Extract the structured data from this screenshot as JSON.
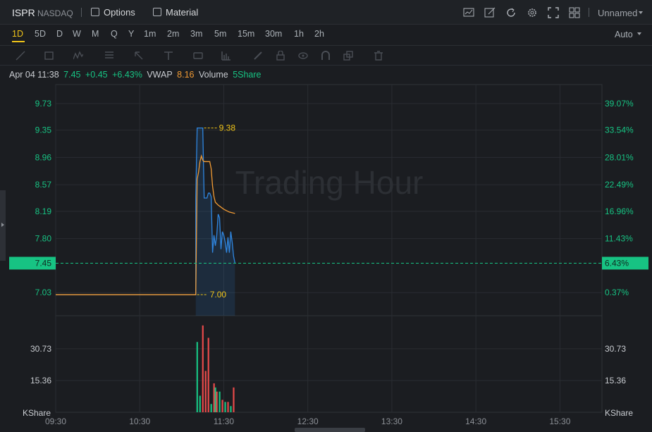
{
  "header": {
    "symbol": "ISPR",
    "exchange": "NASDAQ",
    "options_label": "Options",
    "material_label": "Material",
    "layout_name": "Unnamed"
  },
  "timeframes": {
    "items": [
      "1D",
      "5D",
      "D",
      "W",
      "M",
      "Q",
      "Y",
      "1m",
      "2m",
      "3m",
      "5m",
      "15m",
      "30m",
      "1h",
      "2h"
    ],
    "active": "1D",
    "scale_mode": "Auto"
  },
  "info_bar": {
    "datetime": "Apr 04 11:38",
    "price": "7.45",
    "change": "+0.45",
    "change_pct": "+6.43%",
    "vwap_label": "VWAP",
    "vwap_value": "8.16",
    "volume_label": "Volume",
    "volume_value": "5Share"
  },
  "watermark": "Trading Hour",
  "colors": {
    "up": "#17c383",
    "down": "#e84a4a",
    "price_line": "#2f86e0",
    "vwap_line": "#f09a34",
    "label_yellow": "#f0c419",
    "accent": "#f0c419"
  },
  "chart_data": {
    "type": "line",
    "x_ticks": [
      "09:30",
      "10:30",
      "11:30",
      "12:30",
      "13:30",
      "14:30",
      "15:30"
    ],
    "price_ticks": [
      "9.73",
      "9.35",
      "8.96",
      "8.57",
      "8.19",
      "7.80",
      "7.03"
    ],
    "pct_ticks": [
      "39.07%",
      "33.54%",
      "28.01%",
      "22.49%",
      "16.96%",
      "11.43%",
      "0.37%"
    ],
    "last_price_label": "7.45",
    "last_pct_label": "6.43%",
    "high_label": "9.38",
    "low_label": "7.00",
    "ylim": [
      6.7,
      10.0
    ],
    "series": [
      {
        "name": "Price",
        "x": [
          "09:30",
          "11:10",
          "11:10",
          "11:11",
          "11:12",
          "11:13",
          "11:14",
          "11:15",
          "11:16",
          "11:17",
          "11:18",
          "11:19",
          "11:20",
          "11:21",
          "11:22",
          "11:23",
          "11:24",
          "11:25",
          "11:26",
          "11:27",
          "11:28",
          "11:29",
          "11:30",
          "11:31",
          "11:32",
          "11:33",
          "11:34",
          "11:35",
          "11:36",
          "11:37",
          "11:38"
        ],
        "values": [
          7.0,
          7.0,
          8.4,
          9.38,
          9.38,
          9.38,
          9.38,
          9.38,
          8.38,
          8.38,
          8.38,
          8.45,
          8.45,
          8.4,
          7.6,
          7.85,
          7.7,
          7.85,
          8.15,
          8.1,
          7.65,
          7.9,
          7.85,
          7.75,
          7.6,
          7.82,
          7.6,
          7.9,
          7.75,
          7.55,
          7.45
        ]
      },
      {
        "name": "VWAP",
        "x": [
          "09:30",
          "11:10",
          "11:11",
          "11:12",
          "11:13",
          "11:14",
          "11:15",
          "11:16",
          "11:17",
          "11:18",
          "11:19",
          "11:20",
          "11:21",
          "11:22",
          "11:23",
          "11:24",
          "11:26",
          "11:28",
          "11:30",
          "11:32",
          "11:34",
          "11:36",
          "11:38"
        ],
        "values": [
          7.0,
          7.0,
          8.65,
          8.75,
          8.9,
          8.98,
          8.92,
          8.9,
          8.9,
          8.9,
          8.9,
          8.9,
          8.8,
          8.55,
          8.4,
          8.32,
          8.28,
          8.25,
          8.22,
          8.2,
          8.18,
          8.17,
          8.16
        ]
      }
    ],
    "volume": {
      "unit": "KShare",
      "ticks": [
        "30.73",
        "15.36"
      ],
      "ylim": [
        0,
        45
      ],
      "bars": [
        {
          "x": "11:11",
          "v": 34,
          "dir": "up"
        },
        {
          "x": "11:13",
          "v": 8,
          "dir": "up"
        },
        {
          "x": "11:15",
          "v": 42,
          "dir": "down"
        },
        {
          "x": "11:17",
          "v": 20,
          "dir": "down"
        },
        {
          "x": "11:19",
          "v": 36,
          "dir": "down"
        },
        {
          "x": "11:21",
          "v": 4,
          "dir": "up"
        },
        {
          "x": "11:23",
          "v": 14,
          "dir": "down"
        },
        {
          "x": "11:24",
          "v": 12,
          "dir": "up"
        },
        {
          "x": "11:25",
          "v": 10,
          "dir": "down"
        },
        {
          "x": "11:27",
          "v": 10,
          "dir": "up"
        },
        {
          "x": "11:29",
          "v": 6,
          "dir": "down"
        },
        {
          "x": "11:31",
          "v": 5,
          "dir": "up"
        },
        {
          "x": "11:33",
          "v": 5,
          "dir": "down"
        },
        {
          "x": "11:35",
          "v": 3,
          "dir": "up"
        },
        {
          "x": "11:37",
          "v": 12,
          "dir": "down"
        }
      ]
    }
  }
}
